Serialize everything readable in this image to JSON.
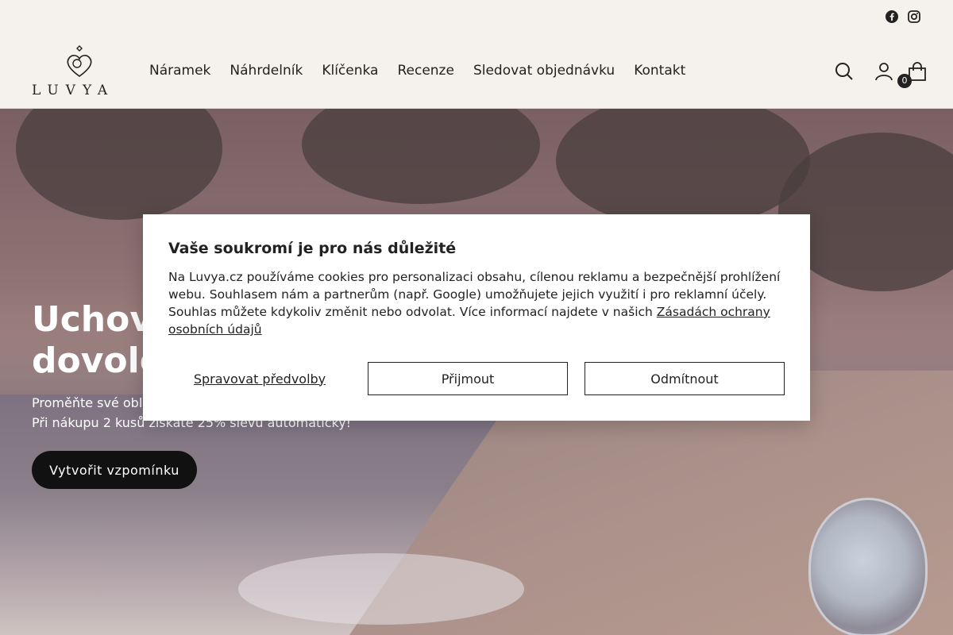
{
  "social": {
    "facebook": "facebook-icon",
    "instagram": "instagram-icon"
  },
  "logo": {
    "text": "LUVYA"
  },
  "nav": [
    {
      "label": "Náramek"
    },
    {
      "label": "Náhrdelník"
    },
    {
      "label": "Klíčenka"
    },
    {
      "label": "Recenze"
    },
    {
      "label": "Sledovat objednávku"
    },
    {
      "label": "Kontakt"
    }
  ],
  "header_icons": {
    "search": "search-icon",
    "account": "user-icon",
    "cart": "cart-icon",
    "cart_count": "0"
  },
  "hero": {
    "title_line1": "Uchovej",
    "title_line2": "dovolenou",
    "subtitle_line1": "Proměňte své oblíbené",
    "subtitle_line2": "Při nákupu 2 kusů získáte 25% slevu automaticky!",
    "cta": "Vytvořit vzpomínku"
  },
  "cookie_modal": {
    "title": "Vaše soukromí je pro nás důležité",
    "body": "Na Luvya.cz používáme cookies pro personalizaci obsahu, cílenou reklamu a bezpečnější prohlížení webu. Souhlasem nám a partnerům (např. Google) umožňujete jejich využití i pro reklamní účely. Souhlas můžete kdykoliv změnit nebo odvolat. Více informací najdete v našich ",
    "link": "Zásadách ochrany osobních údajů",
    "manage": "Spravovat předvolby",
    "accept": "Přijmout",
    "reject": "Odmítnout"
  },
  "colors": {
    "background": "#f5f1ec",
    "dark": "#111111",
    "modal": "#ffffff"
  }
}
